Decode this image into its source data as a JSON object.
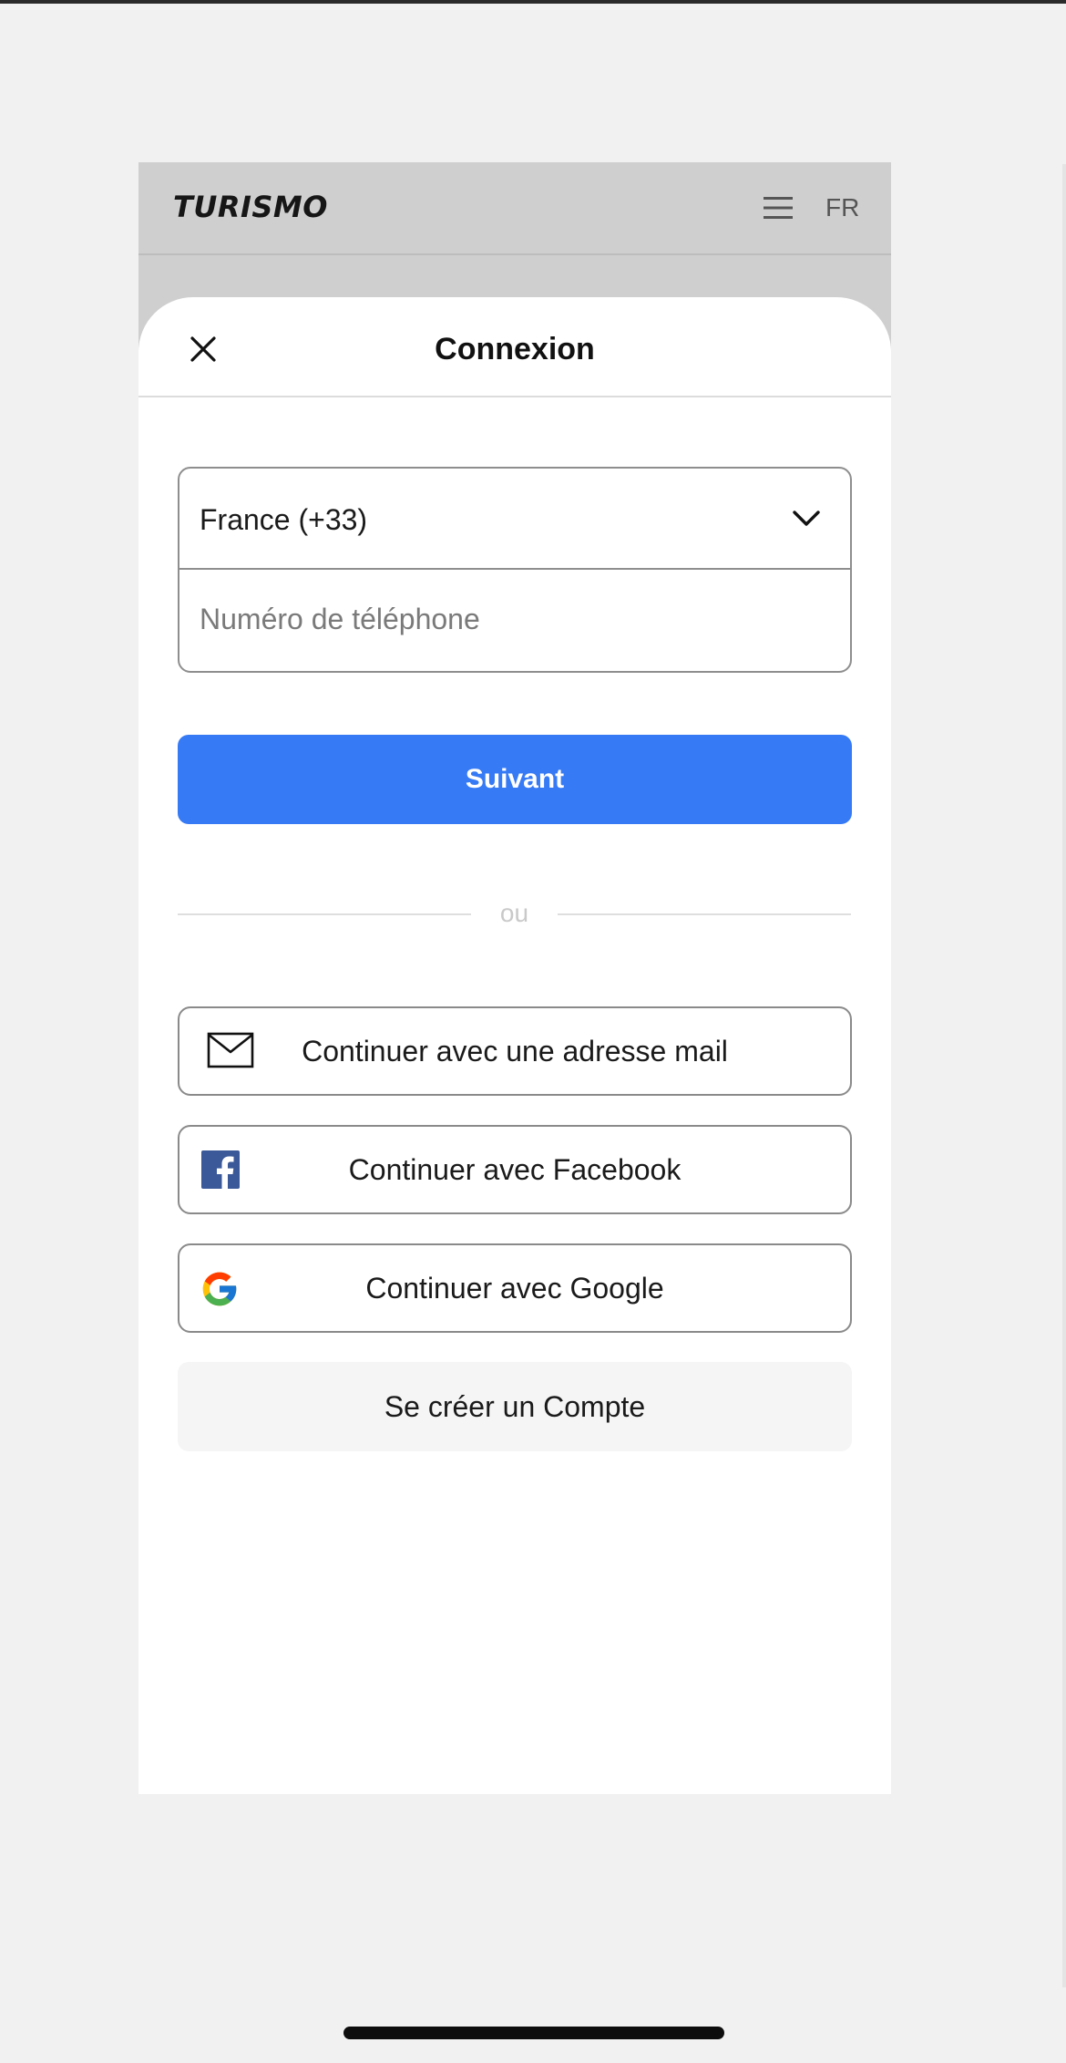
{
  "header": {
    "brand": "TURISMO",
    "language": "FR",
    "menu_icon": "hamburger-menu-icon"
  },
  "sheet": {
    "title": "Connexion",
    "close_icon": "close-icon",
    "country_select": {
      "value": "France (+33)",
      "icon": "chevron-down-icon"
    },
    "phone_input": {
      "placeholder": "Numéro de téléphone",
      "value": ""
    },
    "next_button": "Suivant",
    "divider": "ou",
    "social_buttons": [
      {
        "label": "Continuer avec une adresse mail",
        "icon": "mail-icon"
      },
      {
        "label": "Continuer avec Facebook",
        "icon": "facebook-icon"
      },
      {
        "label": "Continuer avec Google",
        "icon": "google-icon"
      }
    ],
    "create_account_button": "Se créer un Compte"
  },
  "colors": {
    "primary": "#367af5",
    "facebook": "#3b5998",
    "backdrop": "#cfcfcf",
    "page_background": "#f1f1f1"
  }
}
